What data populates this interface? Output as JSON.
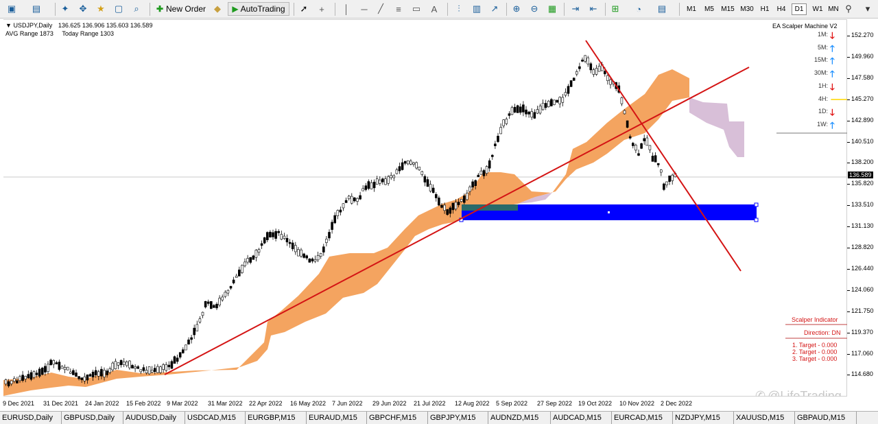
{
  "toolbar": {
    "new_order_label": "New Order",
    "auto_trading_label": "AutoTrading",
    "timeframes": [
      "M1",
      "M5",
      "M15",
      "M30",
      "H1",
      "H4",
      "D1",
      "W1",
      "MN"
    ],
    "active_timeframe": "D1"
  },
  "chart_header": {
    "symbol": "USDJPY,Daily",
    "ohlc": "136.625 136.906 135.603 136.589",
    "avg_range": "AVG Range 1873",
    "today_range": "Today Range 1303"
  },
  "ea_panel": {
    "title": "EA Scalper Machine V2",
    "rows": [
      {
        "tf": "1M:",
        "dir": "down"
      },
      {
        "tf": "5M:",
        "dir": "up"
      },
      {
        "tf": "15M:",
        "dir": "up"
      },
      {
        "tf": "30M:",
        "dir": "up"
      },
      {
        "tf": "1H:",
        "dir": "down"
      },
      {
        "tf": "4H:",
        "dir": "right"
      },
      {
        "tf": "1D:",
        "dir": "down"
      },
      {
        "tf": "1W:",
        "dir": "up"
      }
    ]
  },
  "scalper_indicator": {
    "title": "Scalper Indicator",
    "direction": "Direction: DN",
    "targets": [
      "1. Target - 0.000",
      "2. Target - 0.000",
      "3. Target - 0.000"
    ]
  },
  "price_axis": {
    "labels": [
      "152.270",
      "149.960",
      "147.580",
      "145.270",
      "142.890",
      "140.510",
      "138.200",
      "135.820",
      "133.510",
      "131.130",
      "128.820",
      "126.440",
      "124.060",
      "121.750",
      "119.370",
      "117.060",
      "114.680"
    ],
    "current_price": "136.589"
  },
  "time_axis": {
    "labels": [
      "9 Dec 2021",
      "31 Dec 2021",
      "24 Jan 2022",
      "15 Feb 2022",
      "9 Mar 2022",
      "31 Mar 2022",
      "22 Apr 2022",
      "16 May 2022",
      "7 Jun 2022",
      "29 Jun 2022",
      "21 Jul 2022",
      "12 Aug 2022",
      "5 Sep 2022",
      "27 Sep 2022",
      "19 Oct 2022",
      "10 Nov 2022",
      "2 Dec 2022"
    ]
  },
  "tabs": [
    "EURUSD,Daily",
    "GBPUSD,Daily",
    "AUDUSD,Daily",
    "USDCAD,M15",
    "EURGBP,M15",
    "EURAUD,M15",
    "GBPCHF,M15",
    "GBPJPY,M15",
    "AUDNZD,M15",
    "AUDCAD,M15",
    "EURCAD,M15",
    "NZDJPY,M15",
    "XAUUSD,M15",
    "GBPAUD,M15"
  ],
  "watermark": "@LifeTrading",
  "colors": {
    "cloud_bull": "#f4a460",
    "cloud_bear": "#d8bfd8",
    "trendline": "#d41414",
    "zone": "#0000ff",
    "arrow_up": "#1e90ff",
    "arrow_down": "#e01010",
    "arrow_right": "#ffd700"
  }
}
